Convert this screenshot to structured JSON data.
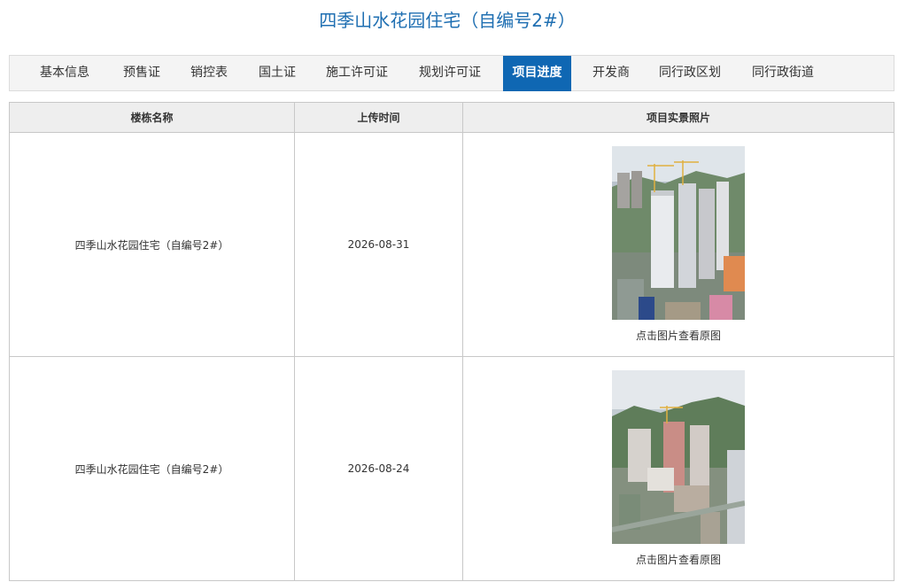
{
  "page": {
    "title": "四季山水花园住宅（自编号2#）"
  },
  "tabs": [
    {
      "label": "基本信息",
      "active": false
    },
    {
      "label": "预售证",
      "active": false
    },
    {
      "label": "销控表",
      "active": false
    },
    {
      "label": "国土证",
      "active": false
    },
    {
      "label": "施工许可证",
      "active": false
    },
    {
      "label": "规划许可证",
      "active": false
    },
    {
      "label": "项目进度",
      "active": true
    },
    {
      "label": "开发商",
      "active": false
    },
    {
      "label": "同行政区划",
      "active": false
    },
    {
      "label": "同行政街道",
      "active": false
    }
  ],
  "table": {
    "headers": [
      "楼栋名称",
      "上传时间",
      "项目实景照片"
    ],
    "rows": [
      {
        "building": "四季山水花园住宅（自编号2#）",
        "upload_date": "2026-08-31",
        "photo_caption": "点击图片查看原图"
      },
      {
        "building": "四季山水花园住宅（自编号2#）",
        "upload_date": "2026-08-24",
        "photo_caption": "点击图片查看原图"
      }
    ]
  },
  "colors": {
    "title": "#1f6fb2",
    "tab_active_bg": "#0f67b3",
    "tab_bar_bg": "#f4f4f4",
    "header_bg": "#eeeeee",
    "border": "#c8c8c8"
  }
}
